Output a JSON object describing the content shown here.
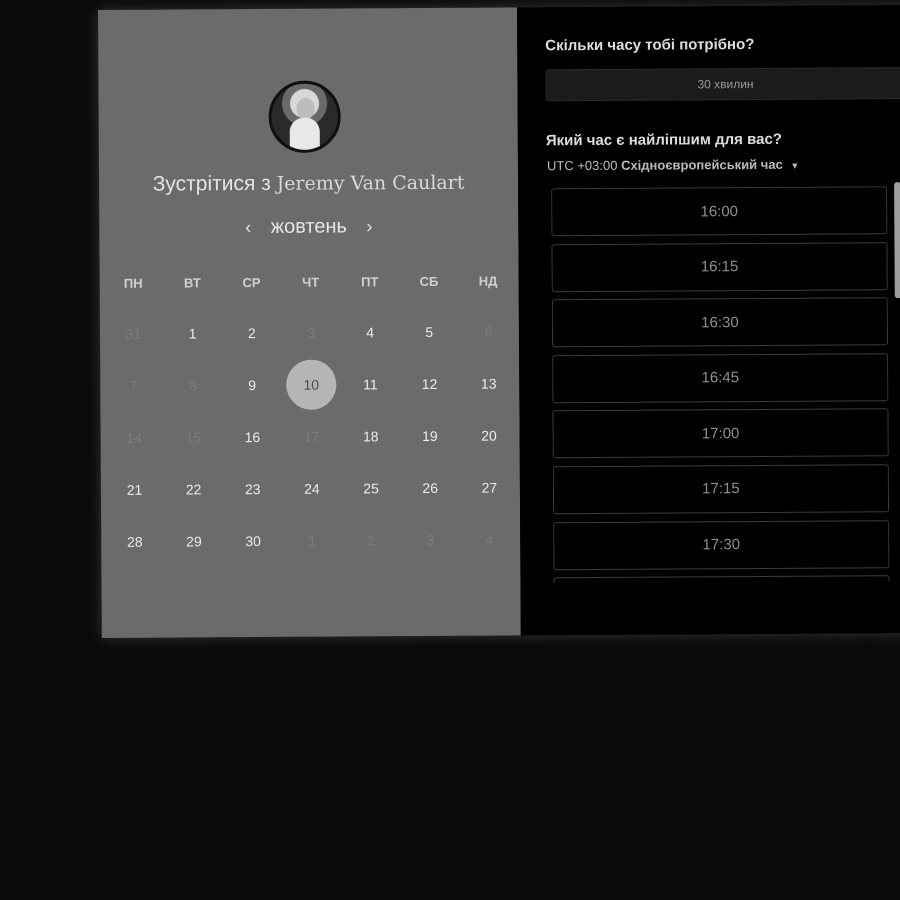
{
  "booking": {
    "meet_prefix": "Зустрітися з",
    "host_name": "Jeremy Van Caulart",
    "avatar_icon": "person-photo-avatar"
  },
  "calendar": {
    "prev_label": "‹",
    "next_label": "›",
    "month": "жовтень",
    "weekdays": [
      "ПН",
      "ВТ",
      "СР",
      "ЧТ",
      "ПТ",
      "СБ",
      "НД"
    ],
    "selected_day": "10",
    "days": [
      {
        "label": "31",
        "muted": true
      },
      {
        "label": "1",
        "muted": false
      },
      {
        "label": "2",
        "muted": false
      },
      {
        "label": "3",
        "muted": true
      },
      {
        "label": "4",
        "muted": false
      },
      {
        "label": "5",
        "muted": false
      },
      {
        "label": "6",
        "muted": true
      },
      {
        "label": "7",
        "muted": true
      },
      {
        "label": "8",
        "muted": true
      },
      {
        "label": "9",
        "muted": false
      },
      {
        "label": "10",
        "muted": false
      },
      {
        "label": "11",
        "muted": false
      },
      {
        "label": "12",
        "muted": false
      },
      {
        "label": "13",
        "muted": false
      },
      {
        "label": "14",
        "muted": true
      },
      {
        "label": "15",
        "muted": true
      },
      {
        "label": "16",
        "muted": false
      },
      {
        "label": "17",
        "muted": true
      },
      {
        "label": "18",
        "muted": false
      },
      {
        "label": "19",
        "muted": false
      },
      {
        "label": "20",
        "muted": false
      },
      {
        "label": "21",
        "muted": false
      },
      {
        "label": "22",
        "muted": false
      },
      {
        "label": "23",
        "muted": false
      },
      {
        "label": "24",
        "muted": false
      },
      {
        "label": "25",
        "muted": false
      },
      {
        "label": "26",
        "muted": false
      },
      {
        "label": "27",
        "muted": false
      },
      {
        "label": "28",
        "muted": false
      },
      {
        "label": "29",
        "muted": false
      },
      {
        "label": "30",
        "muted": false
      },
      {
        "label": "1",
        "muted": true
      },
      {
        "label": "2",
        "muted": true
      },
      {
        "label": "3",
        "muted": true
      },
      {
        "label": "4",
        "muted": true
      }
    ]
  },
  "duration": {
    "question": "Скільки часу тобі потрібно?",
    "value": "30 хвилин"
  },
  "time": {
    "question": "Який час є найліпшим для вас?",
    "tz_offset": "UTC +03:00",
    "tz_name": "Східноєвропейський час",
    "tz_caret": "▼",
    "slots": [
      "16:00",
      "16:15",
      "16:30",
      "16:45",
      "17:00",
      "17:15",
      "17:30",
      ""
    ]
  }
}
